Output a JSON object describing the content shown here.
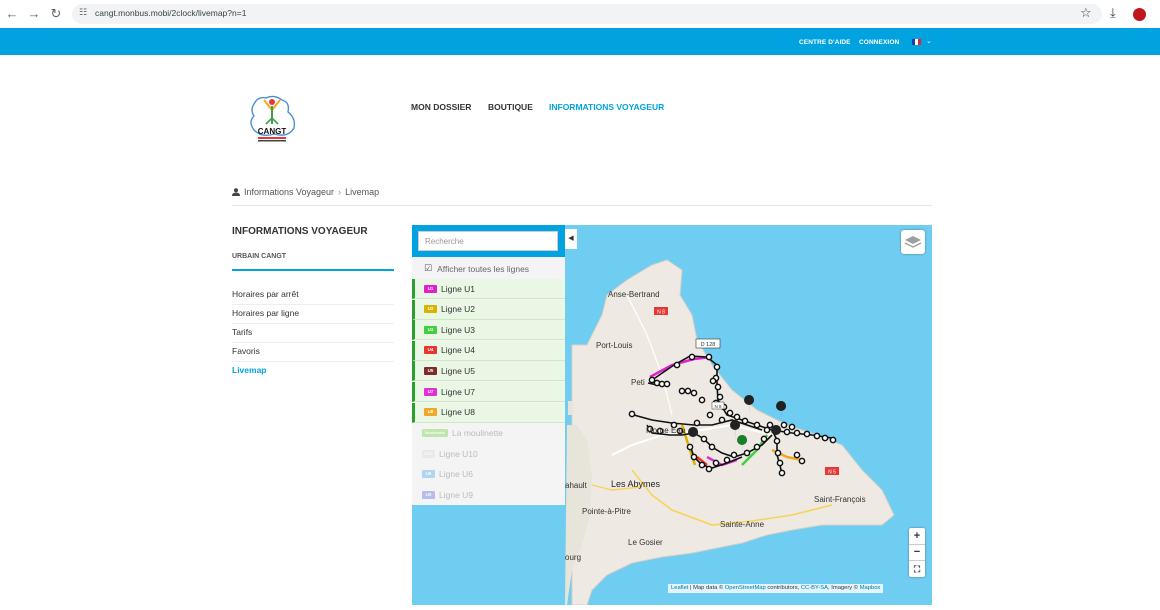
{
  "browser": {
    "url": "cangt.monbus.mobi/2clock/livemap?n=1"
  },
  "topbar": {
    "help": "CENTRE D'AIDE",
    "login": "CONNEXION"
  },
  "logo": {
    "text": "CANGT"
  },
  "nav": {
    "dossier": "MON DOSSIER",
    "boutique": "BOUTIQUE",
    "infos": "INFORMATIONS VOYAGEUR"
  },
  "breadcrumb": {
    "home": "Informations Voyageur",
    "separator": "›",
    "current": "Livemap"
  },
  "sidebar": {
    "title": "INFORMATIONS VOYAGEUR",
    "subtitle": "URBAIN CANGT",
    "items": [
      "Horaires par arrêt",
      "Horaires par ligne",
      "Tarifs",
      "Favoris",
      "Livemap"
    ],
    "active_index": 4
  },
  "panel": {
    "search_placeholder": "Recherche",
    "show_all": "Afficher toutes les lignes",
    "lines": [
      {
        "code": "U1",
        "label": "Ligne U1",
        "color": "#e020d0",
        "active": true
      },
      {
        "code": "U2",
        "label": "Ligne U2",
        "color": "#d6b300",
        "active": true
      },
      {
        "code": "U3",
        "label": "Ligne U3",
        "color": "#3fcf3f",
        "active": true
      },
      {
        "code": "U4",
        "label": "Ligne U4",
        "color": "#e8362f",
        "active": true
      },
      {
        "code": "U5",
        "label": "Ligne U5",
        "color": "#7b2d2d",
        "active": true
      },
      {
        "code": "U7",
        "label": "Ligne U7",
        "color": "#e52fd6",
        "active": true
      },
      {
        "code": "U8",
        "label": "Ligne U8",
        "color": "#f3a623",
        "active": true
      },
      {
        "code": "Moulinette",
        "label": "La moulinette",
        "color": "#7ed957",
        "active": false
      },
      {
        "code": "U10",
        "label": "Ligne U10",
        "color": "#dddddd",
        "active": false
      },
      {
        "code": "U6",
        "label": "Ligne U6",
        "color": "#5bb3f0",
        "active": false
      },
      {
        "code": "U9",
        "label": "Ligne U9",
        "color": "#6c7bdc",
        "active": false
      }
    ]
  },
  "map": {
    "places": [
      "Anse-Bertrand",
      "Port-Louis",
      "Petit",
      "Morne-à-l'Eau",
      "Les Abymes",
      "Pointe-à-Pitre",
      "Le Gosier",
      "Sainte-Anne",
      "Saint-François",
      "Bourg",
      "Mahault"
    ],
    "shown_places": {
      "anse": "Anse-Bertrand",
      "port": "Port-Louis",
      "petit": "Peti",
      "morne_a": "Morne",
      "morne_b": "Eau",
      "abymes": "Les Abymes",
      "pap": "Pointe-à-Pitre",
      "gosier": "Le Gosier",
      "ste_anne": "Sainte-Anne",
      "st_francois": "Saint-François",
      "bourg": "ourg",
      "mahault": "ahault"
    },
    "roads": {
      "n8a": "N 8",
      "n8b": "N 8",
      "d128": "D 128",
      "n5": "N 5"
    },
    "attribution": {
      "leaflet": "Leaflet",
      "map_data": " | Map data © ",
      "osm": "OpenStreetMap",
      "contributors": " contributors, ",
      "license": "CC-BY-SA",
      "imagery": ", Imagery © ",
      "mapbox": "Mapbox"
    },
    "zoom_in": "+",
    "zoom_out": "−",
    "fullscreen": "⛶"
  }
}
